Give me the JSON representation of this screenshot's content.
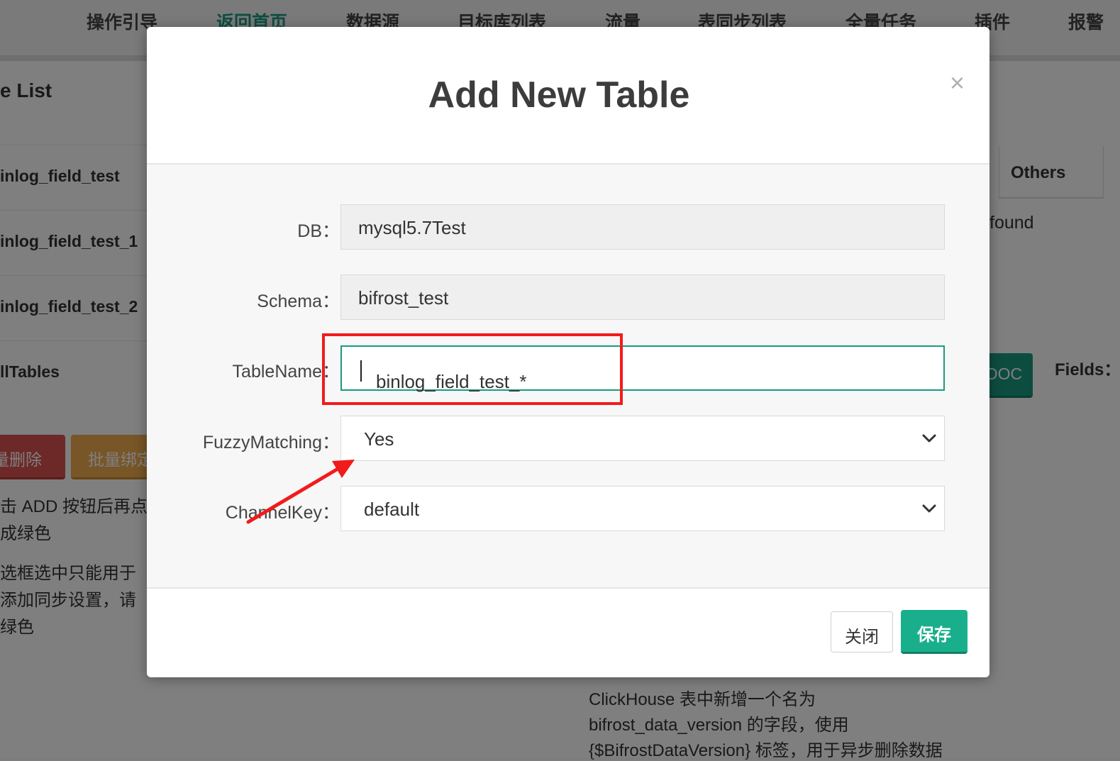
{
  "nav": {
    "items": [
      "操作引导",
      "返回首页",
      "数据源",
      "目标库列表",
      "流量",
      "表同步列表",
      "全量任务",
      "插件",
      "报警"
    ],
    "active_index": 1
  },
  "background": {
    "list_title": "e List",
    "rows": [
      "inlog_field_test",
      "inlog_field_test_1",
      "inlog_field_test_2",
      "llTables"
    ],
    "batch_delete": "量删除",
    "batch_bind": "批量绑定",
    "note1_line1": "击 ADD 按钮后再点",
    "note1_line2": "成绿色",
    "note2_line1": "选框选中只能用于",
    "note2_line2": "添加同步设置，请",
    "note2_line3": "绿色",
    "others_header": "Others",
    "found_text": "found",
    "doc_button": "DOC",
    "fields_label": "Fields：",
    "bottom_line1": "ClickHouse 表中新增一个名为",
    "bottom_line2": "bifrost_data_version 的字段，使用",
    "bottom_line3": "{$BifrostDataVersion} 标签，用于异步删除数据"
  },
  "modal": {
    "title": "Add New Table",
    "close_symbol": "×",
    "fields": {
      "db": {
        "label": "DB：",
        "value": "mysql5.7Test"
      },
      "schema": {
        "label": "Schema：",
        "value": "bifrost_test"
      },
      "table_name": {
        "label": "TableName：",
        "value": "binlog_field_test_*"
      },
      "fuzzy_matching": {
        "label": "FuzzyMatching：",
        "value": "Yes"
      },
      "channel_key": {
        "label": "ChannelKey：",
        "value": "default"
      }
    },
    "close_button": "关闭",
    "save_button": "保存"
  },
  "colors": {
    "accent": "#1a9b80",
    "annotation": "#f21b1b"
  }
}
